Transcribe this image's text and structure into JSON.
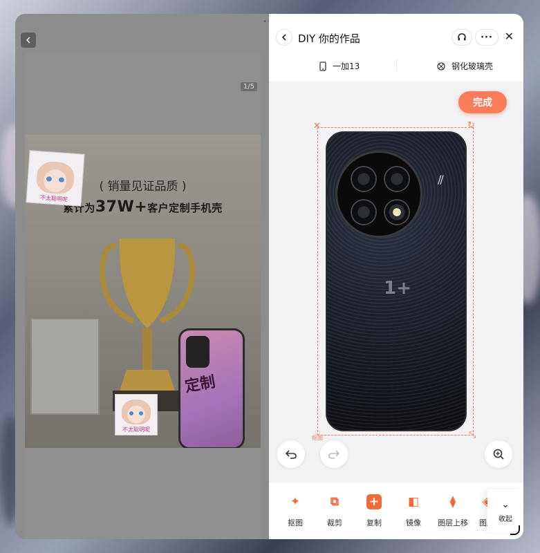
{
  "left": {
    "page_indicator": "1/5",
    "promo_title": "销量见证品质",
    "promo_subtitle_prefix": "累计为",
    "promo_subtitle_number": "37W+",
    "promo_subtitle_suffix": "客户定制手机壳",
    "phone_text": "定制",
    "sticker_caption": "不太聪明呢"
  },
  "header": {
    "title": "DIY 你的作品",
    "model": "一加13",
    "material": "钢化玻璃壳"
  },
  "editor": {
    "done_label": "完成",
    "handle_label": "抠图"
  },
  "toolbar": {
    "items": [
      {
        "label": "抠图"
      },
      {
        "label": "裁剪"
      },
      {
        "label": "复制"
      },
      {
        "label": "镜像"
      },
      {
        "label": "图层上移"
      },
      {
        "label": "图层"
      }
    ],
    "collapse_label": "收起"
  },
  "colors": {
    "accent": "#f67c5a"
  }
}
